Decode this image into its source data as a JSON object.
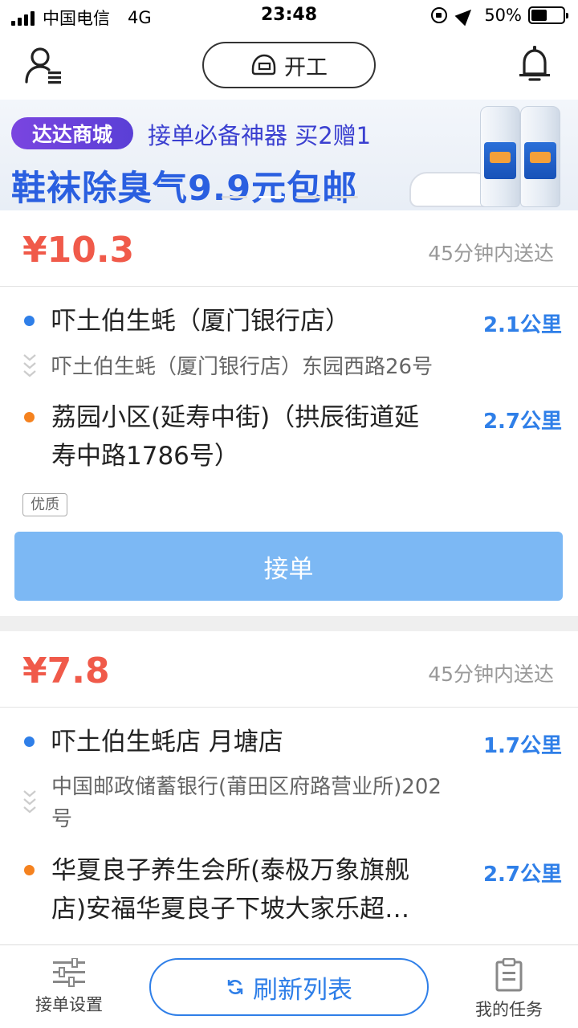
{
  "status_bar": {
    "carrier": "中国电信",
    "network": "4G",
    "time": "23:48",
    "battery": "50%"
  },
  "header": {
    "start_label": "开工",
    "icons": [
      "user-menu-icon",
      "helmet-icon",
      "bell-icon"
    ]
  },
  "banner": {
    "tag": "达达商城",
    "subtitle": "接单必备神器 买2赠1",
    "headline": "鞋袜除臭气9.9元包邮"
  },
  "orders": [
    {
      "price": "¥10.3",
      "eta": "45分钟内送达",
      "pickup_name": "吓土伯生蚝（厦门银行店）",
      "pickup_distance": "2.1公里",
      "pickup_address": "吓土伯生蚝（厦门银行店）东园西路26号",
      "dropoff_name_line1": "荔园小区(延寿中街)（拱辰街道延",
      "dropoff_name_line2": "寿中路1786号）",
      "dropoff_distance": "2.7公里",
      "badge": "优质",
      "accept_label": "接单"
    },
    {
      "price": "¥7.8",
      "eta": "45分钟内送达",
      "pickup_name": "吓土伯生蚝店 月塘店",
      "pickup_distance": "1.7公里",
      "pickup_address_line1": "中国邮政储蓄银行(莆田区府路营业所)202",
      "pickup_address_line2": "号",
      "dropoff_name_line1": "华夏良子养生会所(泰极万象旗舰",
      "dropoff_name_line2": "店)安福华夏良子下坡大家乐超…",
      "dropoff_distance": "2.7公里"
    }
  ],
  "bottom_bar": {
    "settings_label": "接单设置",
    "refresh_label": "刷新列表",
    "tasks_label": "我的任务"
  },
  "colors": {
    "price": "#f05a4a",
    "accent_blue": "#2f7fe8",
    "accept_button": "#7cb8f4",
    "pickup_dot": "#2f7fe8",
    "dropoff_dot": "#f5821f"
  }
}
